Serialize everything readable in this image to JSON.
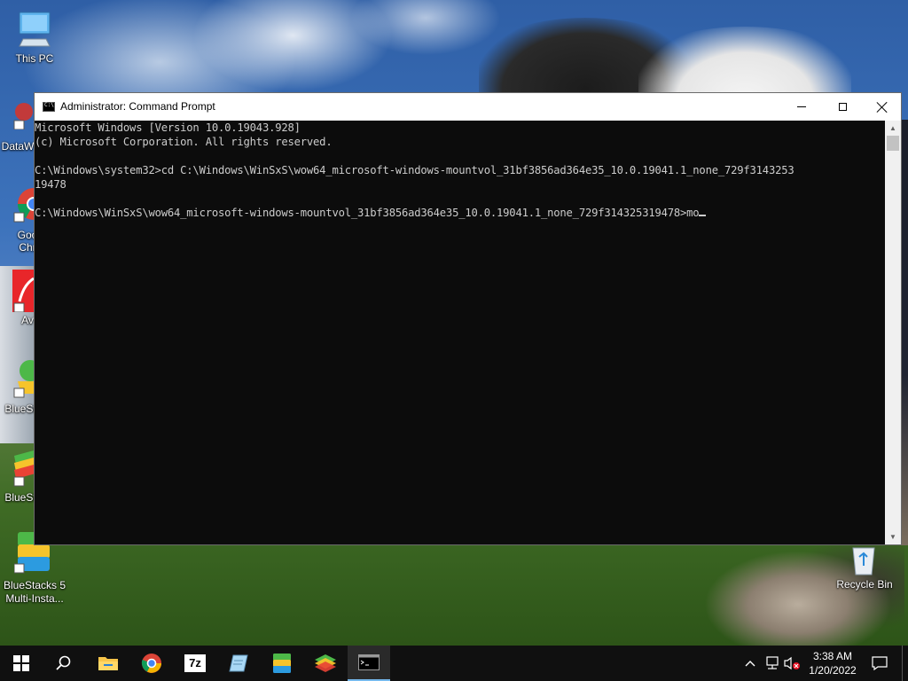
{
  "desktop": {
    "icons": [
      {
        "label": "This PC"
      },
      {
        "label": "DataW"
      },
      {
        "label": "Goo"
      },
      {
        "label": "Chr"
      },
      {
        "label": "Av"
      },
      {
        "label": "BlueSt"
      },
      {
        "label": "BlueSt"
      },
      {
        "label": "BlueStacks 5"
      },
      {
        "label": "Multi-Insta..."
      },
      {
        "label": "Recycle Bin"
      }
    ]
  },
  "window": {
    "title": "Administrator: Command Prompt",
    "console_lines": [
      "Microsoft Windows [Version 10.0.19043.928]",
      "(c) Microsoft Corporation. All rights reserved.",
      "",
      "C:\\Windows\\system32>cd C:\\Windows\\WinSxS\\wow64_microsoft-windows-mountvol_31bf3856ad364e35_10.0.19041.1_none_729f3143253",
      "19478",
      "",
      "C:\\Windows\\WinSxS\\wow64_microsoft-windows-mountvol_31bf3856ad364e35_10.0.19041.1_none_729f314325319478>mo"
    ]
  },
  "taskbar": {
    "items": [
      {
        "icon": "windows-start-icon"
      },
      {
        "icon": "search-icon"
      },
      {
        "icon": "file-explorer-icon"
      },
      {
        "icon": "chrome-icon"
      },
      {
        "icon": "7zip-icon",
        "text": "7z"
      },
      {
        "icon": "notepad-icon"
      },
      {
        "icon": "bluestacks-multi-instance-icon"
      },
      {
        "icon": "bluestacks-icon"
      },
      {
        "icon": "command-prompt-icon"
      }
    ],
    "clock": {
      "time": "3:38 AM",
      "date": "1/20/2022"
    }
  }
}
